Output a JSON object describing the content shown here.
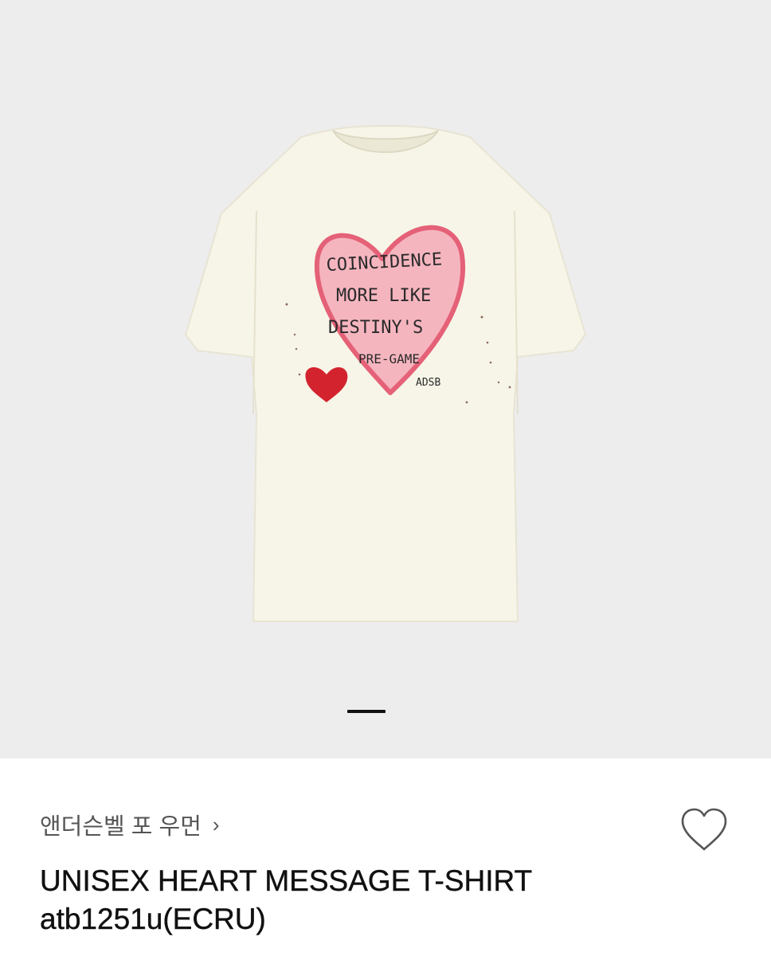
{
  "product": {
    "brand": "앤더슨벨 포 우먼",
    "brand_chevron": "›",
    "title_line1": "UNISEX HEART MESSAGE T-SHIRT",
    "title_line2": "atb1251u(ECRU)",
    "image_text": {
      "line1": "COINCIDENCE",
      "line2": "MORE LIKE",
      "line3": "DESTINY'S",
      "line4": "PRE-GAME",
      "signature": "ADSB"
    }
  },
  "gallery": {
    "current_slide": 1
  },
  "icons": {
    "wishlist": "heart-outline-icon",
    "brand_chevron": "chevron-right-icon"
  },
  "colors": {
    "gallery_background": "#ededee",
    "shirt": "#f7f5e8",
    "heart_pink": "#f3a7b4",
    "heart_outline": "#e45a72",
    "patch_red": "#d3232e",
    "indicator": "#111111"
  }
}
